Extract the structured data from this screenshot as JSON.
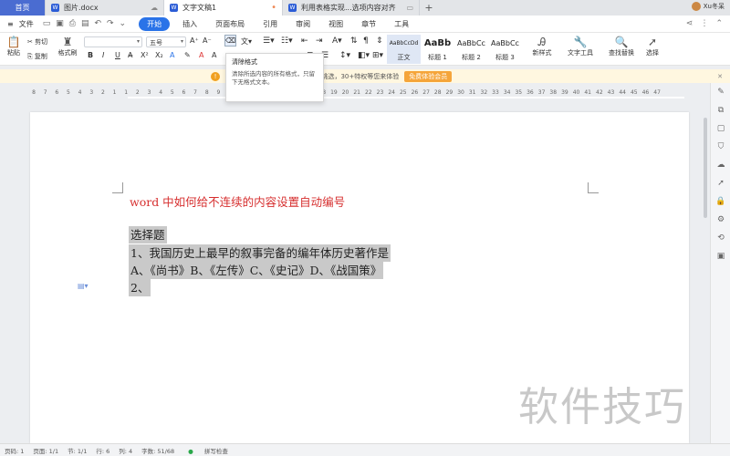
{
  "tabs": [
    {
      "label": "首页"
    },
    {
      "label": "图片.docx"
    },
    {
      "label": "文字文稿1"
    },
    {
      "label": "利用表格实现...选项内容对齐"
    }
  ],
  "user": {
    "name": "Xu冬呆"
  },
  "menu": {
    "file": "文件",
    "items": [
      "开始",
      "插入",
      "页面布局",
      "引用",
      "审阅",
      "视图",
      "章节",
      "工具"
    ]
  },
  "ribbon": {
    "paste": "粘贴",
    "cut": "剪切",
    "copy": "复制",
    "format_painter": "格式刷",
    "font_value": "",
    "size_value": "五号",
    "styles": [
      {
        "preview": "AaBbCcDd",
        "label": "正文"
      },
      {
        "preview": "AaBb",
        "label": "标题 1"
      },
      {
        "preview": "AaBbCc",
        "label": "标题 2"
      },
      {
        "preview": "AaBbCc",
        "label": "标题 3"
      }
    ],
    "new_style": "新样式",
    "text_tools": "文字工具",
    "find_replace": "查找替换",
    "select": "选择"
  },
  "tooltip": {
    "title": "清除格式",
    "desc": "清除所选内容的所有格式，只留下无格式文本。"
  },
  "notice": {
    "text": "格，3种会员任你挑选，30+特权等您来体验",
    "button": "免费体验会员"
  },
  "ruler": {
    "numbers": [
      "8",
      "7",
      "6",
      "5",
      "4",
      "3",
      "2",
      "1",
      "1",
      "2",
      "3",
      "4",
      "5",
      "6",
      "7",
      "8",
      "9",
      "10",
      "11",
      "12",
      "13",
      "14",
      "15",
      "16",
      "17",
      "18",
      "19",
      "20",
      "21",
      "22",
      "23",
      "24",
      "25",
      "26",
      "27",
      "28",
      "29",
      "30",
      "31",
      "32",
      "33",
      "34",
      "35",
      "36",
      "37",
      "38",
      "39",
      "40",
      "41",
      "42",
      "43",
      "44",
      "45",
      "46",
      "47"
    ]
  },
  "document": {
    "title": "word 中如何给不连续的内容设置自动编号",
    "lines": [
      "选择题",
      "1、我国历史上最早的叙事完备的编年体历史著作是",
      "A、《尚书》B、《左传》C、《史记》D、《战国策》",
      "2、"
    ]
  },
  "watermark": "软件技巧",
  "status": {
    "page": "页码: 1",
    "pages": "页面: 1/1",
    "section": "节: 1/1",
    "row": "行: 6",
    "col": "列: 4",
    "words": "字数: 51/68",
    "spell": "拼写检查"
  }
}
